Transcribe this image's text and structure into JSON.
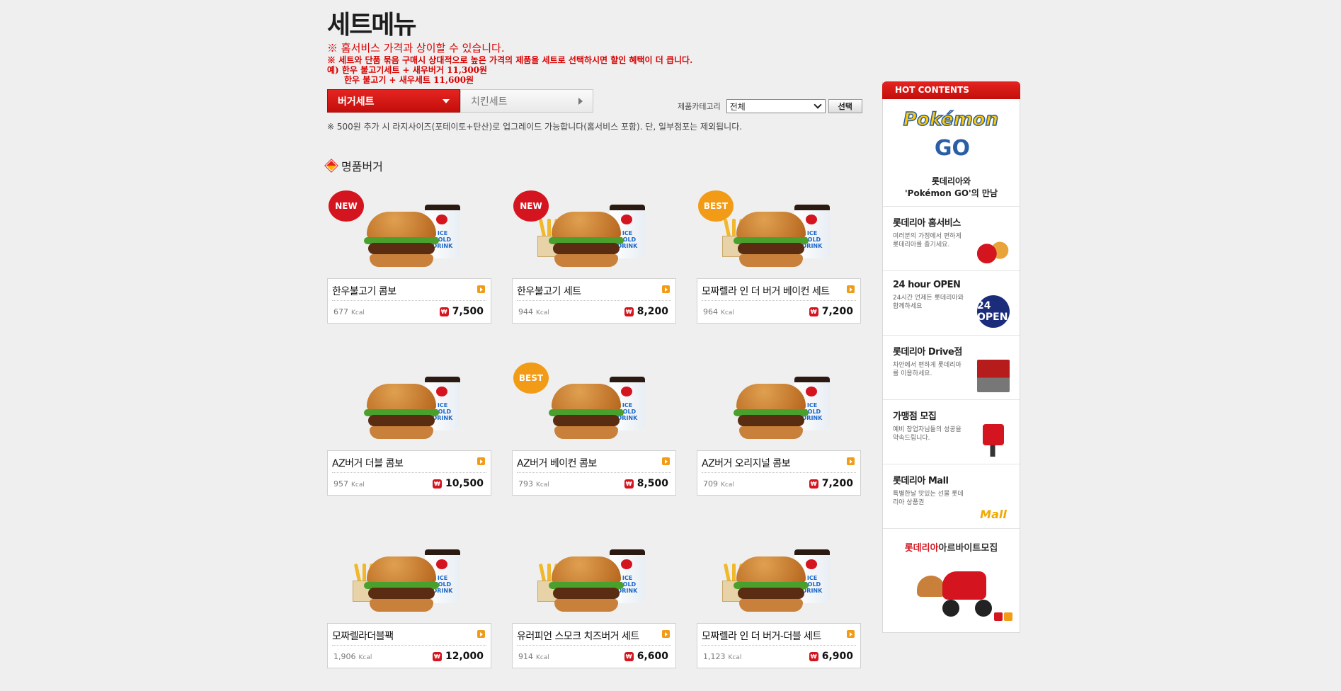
{
  "page": {
    "title": "세트메뉴",
    "notices": [
      "※ 홈서비스 가격과 상이할 수 있습니다.",
      "※ 세트와 단품 묶음 구매시 상대적으로 높은 가격의 제품을 세트로 선택하시면 할인 혜택이 더 큽니다.",
      "예) 한우 불고기세트 + 새우버거 11,300원",
      "한우 불고기 + 새우세트 11,600원"
    ],
    "tabs": [
      {
        "label": "버거세트",
        "active": true
      },
      {
        "label": "치킨세트",
        "active": false
      }
    ],
    "filter": {
      "label": "제품카테고리",
      "selected": "전체",
      "button": "선택"
    },
    "upgrade_note": "※ 500원 추가 시 라지사이즈(포테이토+탄산)로 업그레이드 가능합니다(홈서비스 포함). 단, 일부점포는 제외됩니다."
  },
  "section": {
    "title": "명품버거"
  },
  "products": [
    {
      "name": "한우불고기 콤보",
      "kcal": "677",
      "kcal_unit": "Kcal",
      "price": "7,500",
      "badge": "NEW",
      "fries": false
    },
    {
      "name": "한우불고기 세트",
      "kcal": "944",
      "kcal_unit": "Kcal",
      "price": "8,200",
      "badge": "NEW",
      "fries": true
    },
    {
      "name": "모짜렐라 인 더 버거 베이컨 세트",
      "kcal": "964",
      "kcal_unit": "Kcal",
      "price": "7,200",
      "badge": "BEST",
      "fries": true
    },
    {
      "name": "AZ버거 더블 콤보",
      "kcal": "957",
      "kcal_unit": "Kcal",
      "price": "10,500",
      "badge": "",
      "fries": false
    },
    {
      "name": "AZ버거 베이컨 콤보",
      "kcal": "793",
      "kcal_unit": "Kcal",
      "price": "8,500",
      "badge": "BEST",
      "fries": false
    },
    {
      "name": "AZ버거 오리지널 콤보",
      "kcal": "709",
      "kcal_unit": "Kcal",
      "price": "7,200",
      "badge": "",
      "fries": false
    },
    {
      "name": "모짜렐라더블팩",
      "kcal": "1,906",
      "kcal_unit": "Kcal",
      "price": "12,000",
      "badge": "",
      "fries": true
    },
    {
      "name": "유러피언 스모크 치즈버거 세트",
      "kcal": "914",
      "kcal_unit": "Kcal",
      "price": "6,600",
      "badge": "",
      "fries": true
    },
    {
      "name": "모짜렐라 인 더 버거-더블 세트",
      "kcal": "1,123",
      "kcal_unit": "Kcal",
      "price": "6,900",
      "badge": "",
      "fries": true
    }
  ],
  "currency_icon": "₩",
  "drink_text": "ICE COLD DRINK",
  "sidebar": {
    "header": "HOT CONTENTS",
    "promo": {
      "logo_top": "Pokémon",
      "logo_bottom": "GO",
      "line1": "롯데리아와",
      "line2": "'Pokémon GO'의 만남"
    },
    "items": [
      {
        "title": "롯데리아 홈서비스",
        "desc": "여러분의 가정에서 편하게 롯데리아를 즐기세요.",
        "thumb": "scooter-icon"
      },
      {
        "title": "24 hour OPEN",
        "desc": "24시간 언제든 롯데리아와 함께하세요",
        "thumb": "24-open-icon",
        "thumb_text": "24 OPEN"
      },
      {
        "title": "롯데리아 Drive점",
        "desc": "차안에서 편하게 롯데리아를 이용하세요.",
        "thumb": "drive-store-icon"
      },
      {
        "title": "가맹점 모집",
        "desc": "예비 창업자님들의 성공을 약속드립니다.",
        "thumb": "store-sign-icon"
      },
      {
        "title": "롯데리아 Mall",
        "desc": "특별한날 맛있는 선물 롯데리아 상품권",
        "thumb": "mall-icon",
        "thumb_text": "Mall"
      }
    ],
    "bottom": {
      "brand": "롯데리아",
      "title": "아르바이트모집"
    }
  }
}
